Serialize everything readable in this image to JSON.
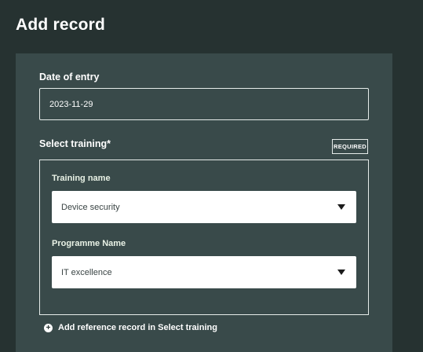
{
  "page": {
    "title": "Add record"
  },
  "form": {
    "date_of_entry": {
      "label": "Date of entry",
      "value": "2023-11-29"
    },
    "select_training": {
      "label": "Select training*",
      "required_badge": "REQUIRED",
      "training_name": {
        "label": "Training name",
        "value": "Device security",
        "icon": "chevron-down-icon"
      },
      "programme_name": {
        "label": "Programme Name",
        "value": "IT excellence",
        "icon": "chevron-down-icon"
      },
      "add_reference": {
        "icon": "plus-icon",
        "glyph": "+",
        "label": "Add reference record in Select training"
      }
    }
  },
  "colors": {
    "background": "#263231",
    "card": "#394a4a",
    "border": "#e6ecea",
    "input_bg": "#ffffff"
  }
}
